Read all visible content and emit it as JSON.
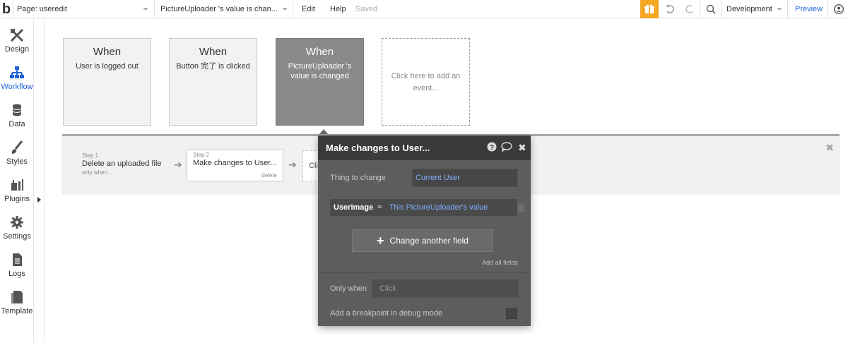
{
  "topbar": {
    "logo": "b",
    "page_label": "Page: useredit",
    "event_selector": "PictureUploader 's value is chan...",
    "menu_edit": "Edit",
    "menu_help": "Help",
    "saved_status": "Saved",
    "env_selector": "Development",
    "preview": "Preview",
    "accent_color": "#f5a623"
  },
  "sidebar": {
    "items": [
      {
        "label": "Design",
        "icon": "design-icon"
      },
      {
        "label": "Workflow",
        "icon": "workflow-icon"
      },
      {
        "label": "Data",
        "icon": "database-icon"
      },
      {
        "label": "Styles",
        "icon": "brush-icon"
      },
      {
        "label": "Plugins",
        "icon": "plug-icon"
      },
      {
        "label": "Settings",
        "icon": "gear-icon"
      },
      {
        "label": "Logs",
        "icon": "document-icon"
      },
      {
        "label": "Template",
        "icon": "template-icon"
      }
    ],
    "active": "Workflow"
  },
  "events": [
    {
      "when": "When",
      "condition": "User is logged out"
    },
    {
      "when": "When",
      "condition": "Button 完了 is clicked"
    },
    {
      "when": "When",
      "condition": "PictureUploader 's value is changed"
    }
  ],
  "add_event": "Click here to add an event...",
  "steps": [
    {
      "num": "Step 1",
      "name": "Delete an uploaded file",
      "extra": "only when..."
    },
    {
      "num": "Step 2",
      "name": "Make changes to User...",
      "extra": "delete"
    }
  ],
  "step3_text": "Cli",
  "dialog": {
    "title": "Make changes to User...",
    "thing_label": "Thing to change",
    "thing_value": "Current User",
    "field_name": "UserImage",
    "field_eq": "=",
    "field_value": "This PictureUploader's value",
    "change_button": "Change another field",
    "add_all": "Add all fields",
    "only_when_label": "Only when",
    "only_when_placeholder": "Click",
    "debug_label": "Add a breakpoint in debug mode"
  }
}
